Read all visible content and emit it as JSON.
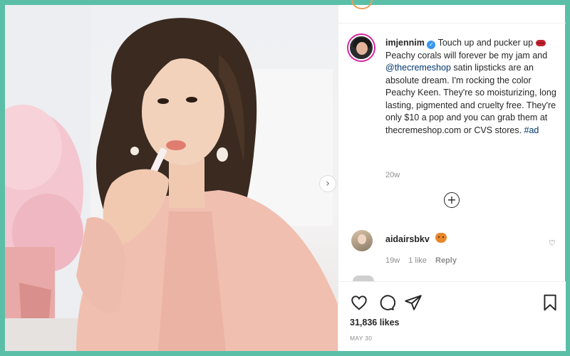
{
  "post": {
    "username": "imjennim",
    "caption_parts": {
      "intro": "Touch up and pucker up",
      "after_lips": "Peachy corals will forever be my jam and",
      "mention": "@thecremeshop",
      "body": "satin lipsticks are an absolute dream. I'm rocking the color Peachy Keen. They're so moisturizing, long lasting, pigmented and cruelty free. They're only $10 a pop and you can grab them at thecremeshop.com or CVS stores.",
      "hashtag": "#ad"
    },
    "time_ago": "20w",
    "likes": "31,836 likes",
    "date": "MAY 30"
  },
  "comment": {
    "username": "aidairsbkv",
    "time_ago": "19w",
    "likes": "1 like",
    "reply_label": "Reply"
  },
  "icons": {
    "verified": "verified-badge-icon",
    "load_more": "add-circle-icon",
    "like": "heart-icon",
    "comment": "comment-bubble-icon",
    "share": "paper-plane-icon",
    "save": "bookmark-icon",
    "next": "chevron-right-icon"
  },
  "colors": {
    "frame": "#5bbfa8",
    "link": "#00376b",
    "verified": "#3897f0",
    "story_ring": "#d6249f"
  }
}
